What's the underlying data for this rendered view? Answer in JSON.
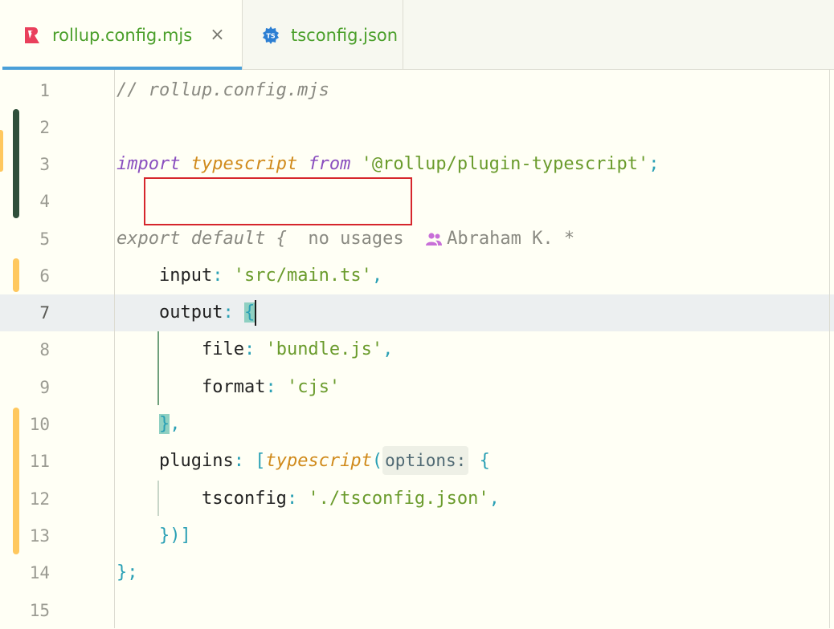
{
  "tabs": [
    {
      "label": "rollup.config.mjs",
      "active": true,
      "icon": "rollup-icon",
      "close": "×"
    },
    {
      "label": "tsconfig.json",
      "active": false,
      "icon": "typescript-config-icon"
    }
  ],
  "editor": {
    "line_numbers": [
      "1",
      "2",
      "3",
      "4",
      "5",
      "6",
      "7",
      "8",
      "9",
      "10",
      "11",
      "12",
      "13",
      "14",
      "15"
    ],
    "current_line": 7,
    "code": {
      "l1": "// rollup.config.mjs",
      "l3_import": "import",
      "l3_id": "typescript",
      "l3_from": "from",
      "l3_str": "'@rollup/plugin-typescript'",
      "l3_semi": ";",
      "l5_export": "export default {",
      "l5_usages": "no usages",
      "l5_author": "Abraham K. *",
      "l6_key": "input",
      "l6_colon": ":",
      "l6_str": "'src/main.ts'",
      "l6_comma": ",",
      "l7_key": "output",
      "l7_colon": ":",
      "l7_brace": "{",
      "l8_key": "file",
      "l8_colon": ":",
      "l8_str": "'bundle.js'",
      "l8_comma": ",",
      "l9_key": "format",
      "l9_colon": ":",
      "l9_str": "'cjs'",
      "l10_brace": "}",
      "l10_comma": ",",
      "l11_key": "plugins",
      "l11_colon": ":",
      "l11_bracket": "[",
      "l11_fn": "typescript",
      "l11_paren": "(",
      "l11_hint": "options:",
      "l11_brace": "{",
      "l12_key": "tsconfig",
      "l12_colon": ":",
      "l12_str": "'./tsconfig.json'",
      "l12_comma": ",",
      "l13_close": "})]",
      "l14_close": "};"
    }
  },
  "colors": {
    "comment": "#8a8a82",
    "keyword": "#8a4fbf",
    "identifier": "#d08a1b",
    "string": "#6a9b2c",
    "punctuation": "#2aa0b5",
    "highlight_box": "#d6262c"
  }
}
